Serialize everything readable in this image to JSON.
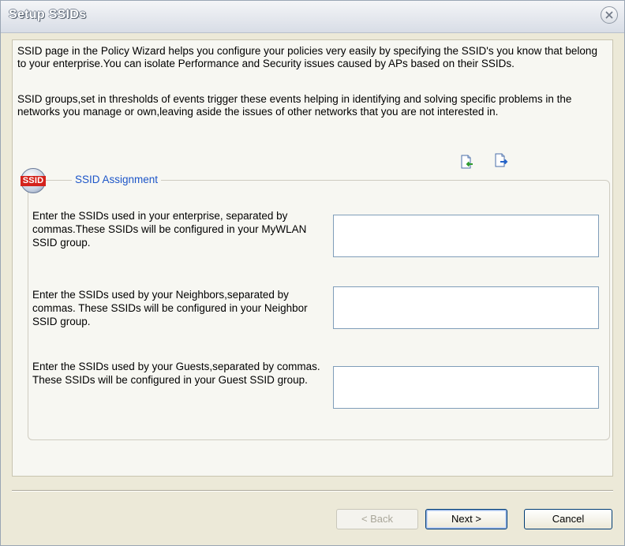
{
  "window": {
    "title": "Setup SSIDs"
  },
  "description": {
    "paragraph1": "SSID page in the Policy Wizard helps you configure your policies very easily by specifying the SSID's you know that  belong to your enterprise.You can isolate Performance and Security issues caused by APs based on their SSIDs.",
    "paragraph2": "SSID groups,set in thresholds of events trigger these events helping in identifying and solving specific problems in the networks you manage or own,leaving aside the issues of other networks that you are not interested in."
  },
  "section": {
    "logo_text": "SSID",
    "title": "SSID Assignment"
  },
  "fields": [
    {
      "label": "Enter the SSIDs used in your enterprise, separated by commas.These SSIDs will be configured in your MyWLAN SSID group.",
      "value": ""
    },
    {
      "label": "Enter the SSIDs used by your Neighbors,separated by commas. These SSIDs will be configured in your Neighbor SSID group.",
      "value": ""
    },
    {
      "label": "Enter the SSIDs used by your Guests,separated by commas. These SSIDs will be configured in your Guest SSID group.",
      "value": ""
    }
  ],
  "buttons": {
    "back": "< Back",
    "next": "Next >",
    "cancel": "Cancel"
  },
  "icons": {
    "import": "import-icon",
    "export": "export-icon",
    "close": "close-icon"
  },
  "colors": {
    "section_title": "#1c55c8",
    "logo_red": "#d4221c",
    "window_bg": "#ece9d8"
  }
}
